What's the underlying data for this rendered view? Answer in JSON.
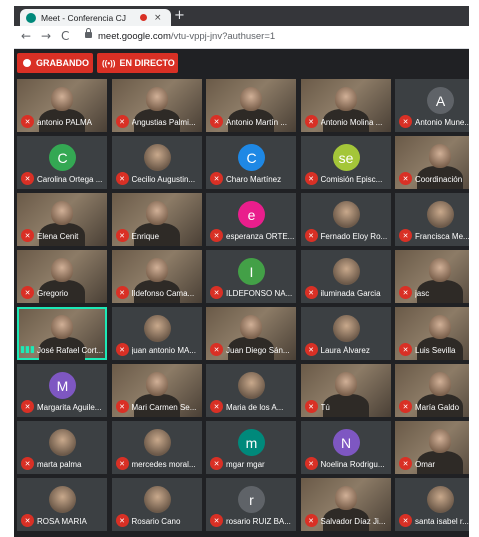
{
  "browser": {
    "tab_title": "Meet - Conferencia CJ",
    "tab_close": "×",
    "new_tab": "+",
    "url_host": "meet.google.com",
    "url_path": "/vtu-vppj-jnv?authuser=1",
    "back": "←",
    "forward": "→",
    "reload": "C"
  },
  "toolbar": {
    "recording_label": "GRABANDO",
    "live_label": "EN DIRECTO",
    "live_icon": "((•))"
  },
  "colors": {
    "record_red": "#d93025",
    "meet_bg": "#202124",
    "speaking_teal": "#1de9b6"
  },
  "participants": [
    {
      "name": "antonio PALMA",
      "tile": "video",
      "muted": true
    },
    {
      "name": "Angustias Palmi...",
      "tile": "video",
      "muted": true
    },
    {
      "name": "Antonio Martín ...",
      "tile": "video",
      "muted": true
    },
    {
      "name": "Antonio Molina ...",
      "tile": "video",
      "muted": true
    },
    {
      "name": "Antonio Mune...",
      "tile": "avatar",
      "initial": "A",
      "color": "#5f6368",
      "muted": true
    },
    {
      "name": "Carolina Ortega ...",
      "tile": "avatar",
      "initial": "C",
      "color": "#34a853",
      "muted": true
    },
    {
      "name": "Cecilio Augustin...",
      "tile": "photo",
      "muted": true
    },
    {
      "name": "Charo Martínez",
      "tile": "avatar",
      "initial": "C",
      "color": "#1e88e5",
      "muted": true
    },
    {
      "name": "Comisión Episc...",
      "tile": "logo",
      "initial": "se",
      "color": "#a4c639",
      "muted": true
    },
    {
      "name": "Coordinación",
      "tile": "video",
      "muted": true
    },
    {
      "name": "Elena Cenit",
      "tile": "video",
      "muted": true
    },
    {
      "name": "Enrique",
      "tile": "video",
      "muted": true
    },
    {
      "name": "esperanza ORTE...",
      "tile": "avatar",
      "initial": "e",
      "color": "#e91e8c",
      "muted": true
    },
    {
      "name": "Fernado Eloy Ro...",
      "tile": "photo",
      "muted": true
    },
    {
      "name": "Francisca Me...",
      "tile": "photo",
      "muted": true
    },
    {
      "name": "Gregorio",
      "tile": "video",
      "muted": true
    },
    {
      "name": "Ildefonso Cama...",
      "tile": "video",
      "muted": true
    },
    {
      "name": "ILDEFONSO NA...",
      "tile": "avatar",
      "initial": "I",
      "color": "#43a047",
      "muted": true
    },
    {
      "name": "iluminada Garcia",
      "tile": "photo",
      "muted": true
    },
    {
      "name": "jasc",
      "tile": "video",
      "muted": true
    },
    {
      "name": "José Rafael Cort...",
      "tile": "video",
      "muted": false,
      "speaking": true
    },
    {
      "name": "juan antonio MA...",
      "tile": "photo",
      "muted": true
    },
    {
      "name": "Juan Diego Sán...",
      "tile": "video",
      "muted": true
    },
    {
      "name": "Laura Álvarez",
      "tile": "photo",
      "muted": true
    },
    {
      "name": "Luis Sevilla",
      "tile": "video",
      "muted": true
    },
    {
      "name": "Margarita Aguile...",
      "tile": "avatar",
      "initial": "M",
      "color": "#7e57c2",
      "muted": true
    },
    {
      "name": "Mari Carmen Se...",
      "tile": "video",
      "muted": true
    },
    {
      "name": "Maria de los A...",
      "tile": "photo",
      "muted": true
    },
    {
      "name": "Tú",
      "tile": "video",
      "muted": true
    },
    {
      "name": "María Galdo",
      "tile": "video",
      "muted": true
    },
    {
      "name": "marta palma",
      "tile": "photo",
      "muted": true
    },
    {
      "name": "mercedes moral...",
      "tile": "photo",
      "muted": true
    },
    {
      "name": "mgar mgar",
      "tile": "avatar",
      "initial": "m",
      "color": "#00897b",
      "muted": true
    },
    {
      "name": "Noelina Rodrigu...",
      "tile": "avatar",
      "initial": "N",
      "color": "#7e57c2",
      "muted": true
    },
    {
      "name": "Omar",
      "tile": "video",
      "muted": true
    },
    {
      "name": "ROSA MARIA",
      "tile": "photo",
      "muted": true
    },
    {
      "name": "Rosario Cano",
      "tile": "photo",
      "muted": true
    },
    {
      "name": "rosario RUIZ BA...",
      "tile": "avatar",
      "initial": "r",
      "color": "#5f6368",
      "muted": true
    },
    {
      "name": "Salvador Díaz Ji...",
      "tile": "video",
      "muted": true
    },
    {
      "name": "santa isabel r...",
      "tile": "photo",
      "muted": true
    }
  ]
}
